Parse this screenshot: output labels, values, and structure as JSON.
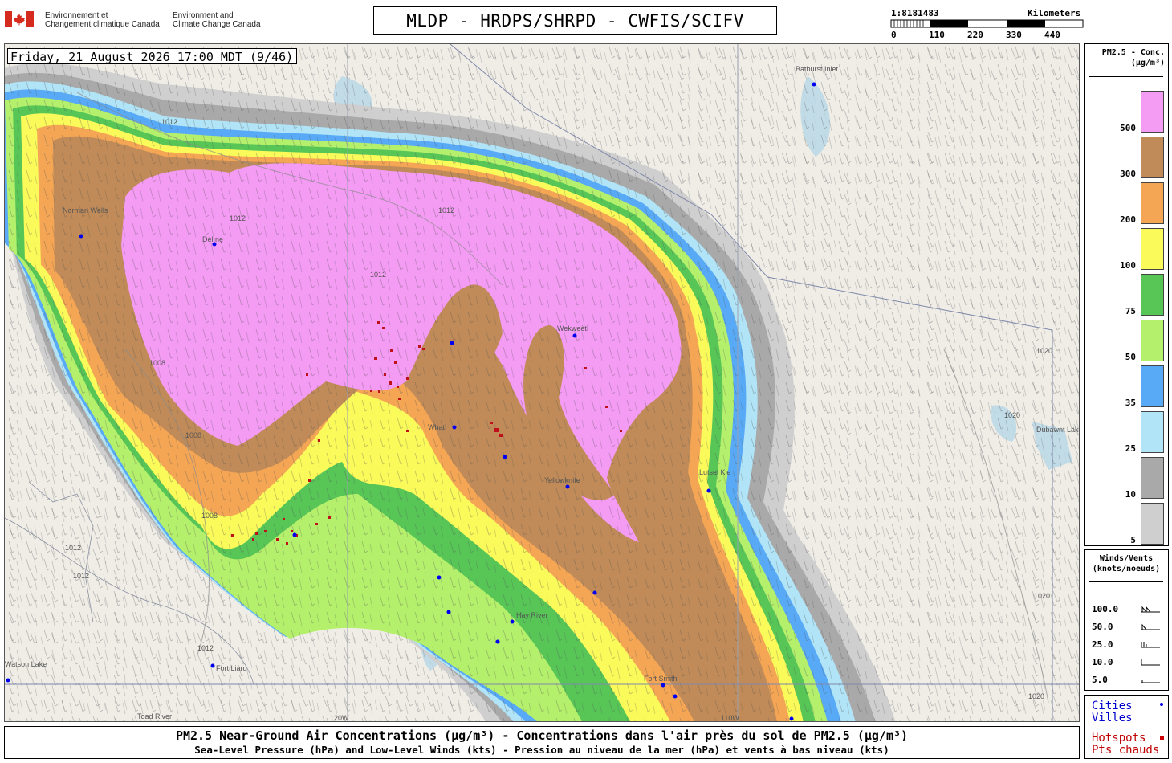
{
  "header": {
    "gov_fr_line1": "Environnement et",
    "gov_fr_line2": "Changement climatique Canada",
    "gov_en_line1": "Environment and",
    "gov_en_line2": "Climate Change Canada",
    "title": "MLDP - HRDPS/SHRPD - CWFIS/SCIFV"
  },
  "scale": {
    "ratio": "1:8181483",
    "unit": "Kilometers",
    "ticks": [
      "0",
      "110",
      "220",
      "330",
      "440"
    ]
  },
  "map": {
    "datetime": "Friday, 21 August 2026 17:00 MDT (9/46)",
    "places": [
      {
        "name": "Bathurst Inlet"
      },
      {
        "name": "Norman Wells"
      },
      {
        "name": "Délı̨nę"
      },
      {
        "name": "Wekweètì"
      },
      {
        "name": "Whatì"
      },
      {
        "name": "Yellowknife"
      },
      {
        "name": "Hay River"
      },
      {
        "name": "Fort Liard"
      },
      {
        "name": "Fort Smith"
      },
      {
        "name": "Lutsel K'e"
      },
      {
        "name": "Toad River"
      },
      {
        "name": "Dubawnt Lake"
      },
      {
        "name": "Watson Lake"
      }
    ],
    "isobars": [
      "1012",
      "1008",
      "1020"
    ],
    "meridians": [
      "120W",
      "110W"
    ]
  },
  "pm_legend": {
    "title_line1": "PM2.5 - Conc.",
    "title_line2": "(µg/m³)",
    "bins": [
      {
        "label": "500",
        "color": "#f49bf4"
      },
      {
        "label": "300",
        "color": "#c08b58"
      },
      {
        "label": "200",
        "color": "#f5a655"
      },
      {
        "label": "100",
        "color": "#fafa5a"
      },
      {
        "label": "75",
        "color": "#57c657"
      },
      {
        "label": "50",
        "color": "#b4f06c"
      },
      {
        "label": "35",
        "color": "#58aaf7"
      },
      {
        "label": "25",
        "color": "#b1e4f7"
      },
      {
        "label": "10",
        "color": "#a9a9a9"
      },
      {
        "label": "5",
        "color": "#cfcfcf"
      }
    ]
  },
  "wind_legend": {
    "title_line1": "Winds/Vents",
    "title_line2": "(knots/noeuds)",
    "items": [
      {
        "label": "100.0"
      },
      {
        "label": "50.0"
      },
      {
        "label": "25.0"
      },
      {
        "label": "10.0"
      },
      {
        "label": "5.0"
      }
    ]
  },
  "key_legend": {
    "cities_en": "Cities",
    "cities_fr": "Villes",
    "hotspots_en": "Hotspots",
    "hotspots_fr": "Pts chauds",
    "city_color": "#0000ff",
    "hotspot_color": "#cc0000"
  },
  "caption": {
    "line1": "PM2.5 Near-Ground Air Concentrations (µg/m³) - Concentrations dans l'air près du sol de PM2.5 (µg/m³)",
    "line2": "Sea-Level Pressure (hPa) and Low-Level Winds (kts) - Pression au niveau de la mer (hPa) et vents à bas niveau (kts)"
  }
}
